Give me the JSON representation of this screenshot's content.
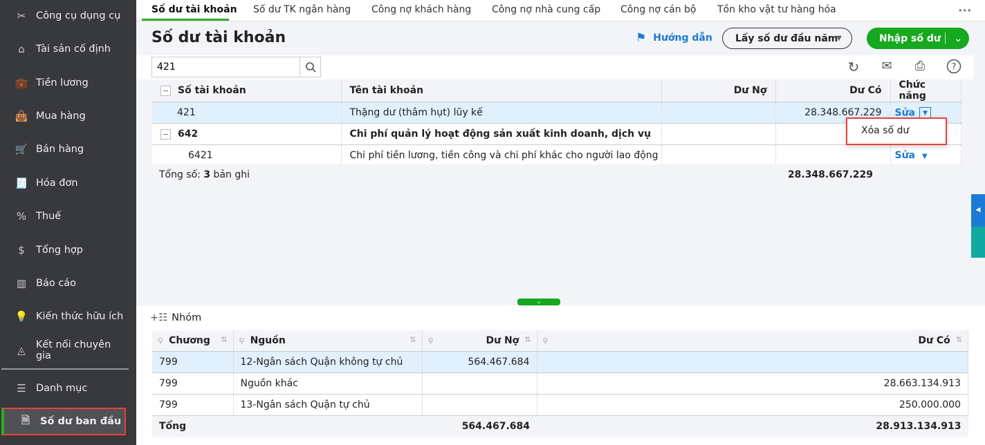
{
  "sidebar": {
    "items": [
      {
        "label": "Công cụ dụng cụ",
        "icon": "tools-icon",
        "glyph": "✂"
      },
      {
        "label": "Tài sản cố định",
        "icon": "asset-icon",
        "glyph": "⌂"
      },
      {
        "label": "Tiền lương",
        "icon": "salary-icon",
        "glyph": "💼"
      },
      {
        "label": "Mua hàng",
        "icon": "bag-icon",
        "glyph": "👜"
      },
      {
        "label": "Bán hàng",
        "icon": "cart-icon",
        "glyph": "🛒"
      },
      {
        "label": "Hóa đơn",
        "icon": "invoice-icon",
        "glyph": "🧾"
      },
      {
        "label": "Thuế",
        "icon": "tax-icon",
        "glyph": "%"
      },
      {
        "label": "Tổng hợp",
        "icon": "summary-icon",
        "glyph": "$"
      },
      {
        "label": "Báo cáo",
        "icon": "report-icon",
        "glyph": "▥"
      },
      {
        "label": "Kiến thức hữu ích",
        "icon": "knowledge-icon",
        "glyph": "💡"
      },
      {
        "label": "Kết nối chuyên gia",
        "icon": "expert-icon",
        "glyph": "◬"
      },
      {
        "label": "Danh mục",
        "icon": "list-icon",
        "glyph": "☰"
      },
      {
        "label": "Số dư ban đầu",
        "icon": "balance-doc-icon",
        "glyph": "🗎"
      }
    ]
  },
  "tabs": [
    "Số dư tài khoản",
    "Số dư TK ngân hàng",
    "Công nợ khách hàng",
    "Công nợ nhà cung cấp",
    "Công nợ cán bộ",
    "Tồn kho vật tư hàng hóa"
  ],
  "more": "•••",
  "title": "Số dư tài khoản",
  "guide": "Hướng dẫn",
  "get_balance": "Lấy số dư đầu năm",
  "enter_balance": "Nhập số dư",
  "search_value": "421",
  "table": {
    "headers": [
      "Số tài khoản",
      "Tên tài khoản",
      "Dư Nợ",
      "Dư Có",
      "Chức năng"
    ],
    "rows": [
      {
        "acc": "421",
        "name": "Thặng dư (thâm hụt) lũy kế",
        "debit": "",
        "credit": "28.348.667.229",
        "action": "Sửa"
      },
      {
        "acc": "642",
        "name": "Chi phí quản lý hoạt động sản xuất kinh doanh, dịch vụ",
        "debit": "",
        "credit": "",
        "action": ""
      },
      {
        "acc": "6421",
        "name": "Chi phí tiền lương, tiền công và chi phí khác cho người lao động",
        "debit": "",
        "credit": "",
        "action": "Sửa"
      }
    ],
    "footer_prefix": "Tổng số: ",
    "footer_count": "3",
    "footer_suffix": " bản ghi",
    "footer_credit": "28.348.667.229"
  },
  "menu": {
    "delete": "Xóa số dư"
  },
  "group": "Nhóm",
  "detail": {
    "headers": [
      "Chương",
      "Nguồn",
      "Dư Nợ",
      "Dư Có"
    ],
    "rows": [
      {
        "ch": "799",
        "src": "12-Ngân sách Quận không tự chủ",
        "debit": "564.467.684",
        "credit": ""
      },
      {
        "ch": "799",
        "src": "Nguồn khác",
        "debit": "",
        "credit": "28.663.134.913"
      },
      {
        "ch": "799",
        "src": "13-Ngân sách Quận tự chủ",
        "debit": "",
        "credit": "250.000.000"
      }
    ],
    "total_label": "Tổng",
    "total_debit": "564.467.684",
    "total_credit": "28.913.134.913"
  },
  "colors": {
    "accent": "#16a81e",
    "link": "#1b7ad6",
    "sidebar": "#38393d",
    "highlight": "#e84141"
  }
}
